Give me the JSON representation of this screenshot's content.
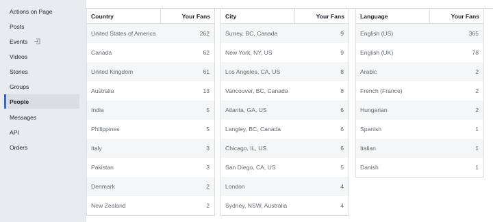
{
  "sidebar": {
    "items": [
      {
        "label": "Actions on Page"
      },
      {
        "label": "Posts"
      },
      {
        "label": "Events"
      },
      {
        "label": "Videos"
      },
      {
        "label": "Stories"
      },
      {
        "label": "Groups"
      },
      {
        "label": "People"
      },
      {
        "label": "Messages"
      },
      {
        "label": "API"
      },
      {
        "label": "Orders"
      }
    ],
    "events_icon": "exit-icon",
    "active": "People",
    "accent_color": "#4267b2"
  },
  "tables": {
    "country": {
      "header": "Country",
      "value_header": "Your Fans",
      "rows": [
        {
          "name": "United States of America",
          "value": "262"
        },
        {
          "name": "Canada",
          "value": "62"
        },
        {
          "name": "United Kingdom",
          "value": "61"
        },
        {
          "name": "Australia",
          "value": "13"
        },
        {
          "name": "India",
          "value": "5"
        },
        {
          "name": "Philippines",
          "value": "5"
        },
        {
          "name": "Italy",
          "value": "3"
        },
        {
          "name": "Pakistan",
          "value": "3"
        },
        {
          "name": "Denmark",
          "value": "2"
        },
        {
          "name": "New Zealand",
          "value": "2"
        }
      ]
    },
    "city": {
      "header": "City",
      "value_header": "Your Fans",
      "rows": [
        {
          "name": "Surrey, BC, Canada",
          "value": "9"
        },
        {
          "name": "New York, NY, US",
          "value": "9"
        },
        {
          "name": "Los Angeles, CA, US",
          "value": "8"
        },
        {
          "name": "Vancouver, BC, Canada",
          "value": "8"
        },
        {
          "name": "Atlanta, GA, US",
          "value": "6"
        },
        {
          "name": "Langley, BC, Canada",
          "value": "6"
        },
        {
          "name": "Chicago, IL, US",
          "value": "6"
        },
        {
          "name": "San Diego, CA, US",
          "value": "5"
        },
        {
          "name": "London",
          "value": "4"
        },
        {
          "name": "Sydney, NSW, Australia",
          "value": "4"
        }
      ]
    },
    "language": {
      "header": "Language",
      "value_header": "Your Fans",
      "rows": [
        {
          "name": "English (US)",
          "value": "365"
        },
        {
          "name": "English (UK)",
          "value": "78"
        },
        {
          "name": "Arabic",
          "value": "2"
        },
        {
          "name": "French (France)",
          "value": "2"
        },
        {
          "name": "Hungarian",
          "value": "2"
        },
        {
          "name": "Spanish",
          "value": "1"
        },
        {
          "name": "Italian",
          "value": "1"
        },
        {
          "name": "Danish",
          "value": "1"
        }
      ]
    }
  }
}
